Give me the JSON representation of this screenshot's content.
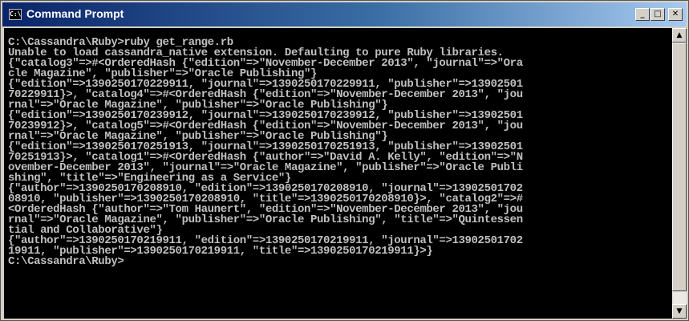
{
  "window": {
    "title": "Command Prompt",
    "icon_label": "C:\\",
    "controls": {
      "minimize": "_",
      "maximize": "□",
      "close": "✕"
    }
  },
  "scrollbar": {
    "up_glyph": "▲",
    "down_glyph": "▼"
  },
  "console": {
    "lines": [
      "C:\\Cassandra\\Ruby>ruby get_range.rb",
      "Unable to load cassandra_native extension. Defaulting to pure Ruby libraries.",
      "{\"catalog3\"=>#<OrderedHash {\"edition\"=>\"November-December 2013\", \"journal\"=>\"Ora",
      "cle Magazine\", \"publisher\"=>\"Oracle Publishing\"}",
      "{\"edition\"=>1390250170229911, \"journal\"=>1390250170229911, \"publisher\"=>13902501",
      "70229911}>, \"catalog4\"=>#<OrderedHash {\"edition\"=>\"November-December 2013\", \"jou",
      "rnal\"=>\"Oracle Magazine\", \"publisher\"=>\"Oracle Publishing\"}",
      "{\"edition\"=>1390250170239912, \"journal\"=>1390250170239912, \"publisher\"=>13902501",
      "70239912}>, \"catalog5\"=>#<OrderedHash {\"edition\"=>\"November-December 2013\", \"jou",
      "rnal\"=>\"Oracle Magazine\", \"publisher\"=>\"Oracle Publishing\"}",
      "{\"edition\"=>1390250170251913, \"journal\"=>1390250170251913, \"publisher\"=>13902501",
      "70251913}>, \"catalog1\"=>#<OrderedHash {\"author\"=>\"David A. Kelly\", \"edition\"=>\"N",
      "ovember-December 2013\", \"journal\"=>\"Oracle Magazine\", \"publisher\"=>\"Oracle Publi",
      "shing\", \"title\"=>\"Engineering as a Service\"}",
      "{\"author\"=>1390250170208910, \"edition\"=>1390250170208910, \"journal\"=>13902501702",
      "08910, \"publisher\"=>1390250170208910, \"title\"=>1390250170208910}>, \"catalog2\"=>#",
      "<OrderedHash {\"author\"=>\"Tom Haunert\", \"edition\"=>\"November-December 2013\", \"jou",
      "rnal\"=>\"Oracle Magazine\", \"publisher\"=>\"Oracle Publishing\", \"title\"=>\"Quintessen",
      "tial and Collaborative\"}",
      "{\"author\"=>1390250170219911, \"edition\"=>1390250170219911, \"journal\"=>13902501702",
      "19911, \"publisher\"=>1390250170219911, \"title\"=>1390250170219911}>}",
      "C:\\Cassandra\\Ruby>"
    ]
  }
}
